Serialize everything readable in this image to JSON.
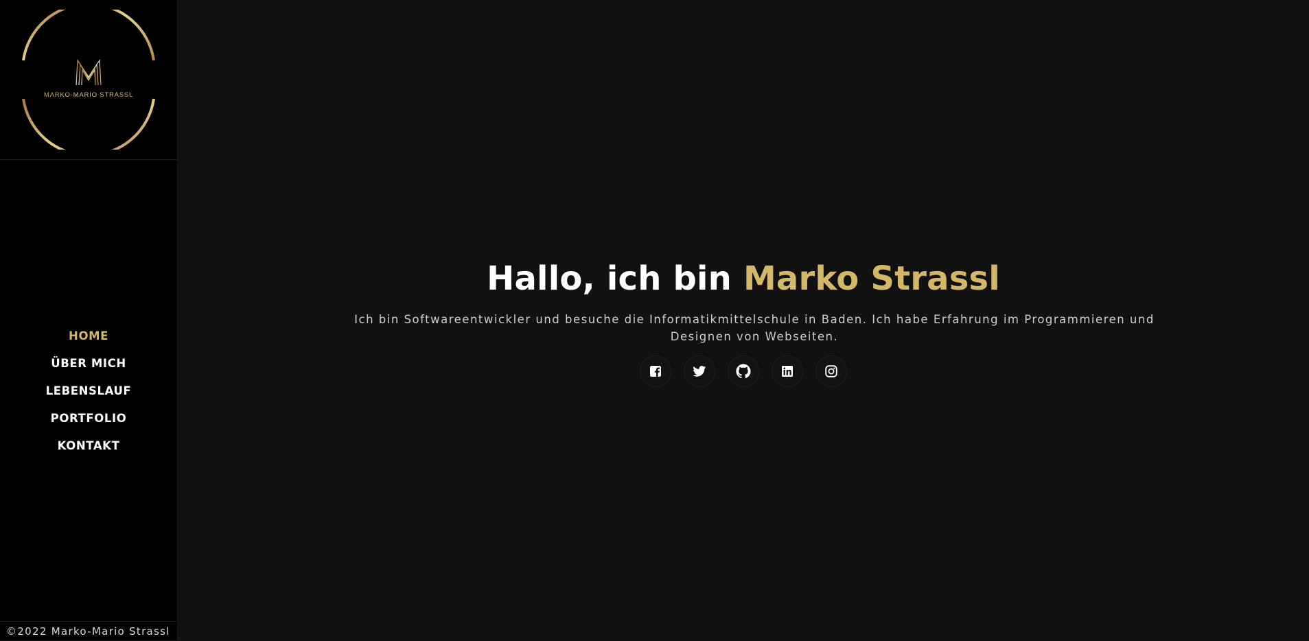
{
  "brand": {
    "logo_letter": "M",
    "logo_text": "MARKO-MARIO STRASSL"
  },
  "nav": {
    "items": [
      {
        "label": "HOME",
        "active": true
      },
      {
        "label": "ÜBER MICH",
        "active": false
      },
      {
        "label": "LEBENSLAUF",
        "active": false
      },
      {
        "label": "PORTFOLIO",
        "active": false
      },
      {
        "label": "KONTAKT",
        "active": false
      }
    ]
  },
  "hero": {
    "title_prefix": "Hallo, ich bin ",
    "title_name": "Marko Strassl",
    "description": "Ich bin Softwareentwickler und besuche die Informatikmittelschule in Baden. Ich habe Erfahrung im Programmieren und Designen von Webseiten."
  },
  "socials": [
    {
      "icon": "facebook-icon"
    },
    {
      "icon": "twitter-icon"
    },
    {
      "icon": "github-icon"
    },
    {
      "icon": "linkedin-icon"
    },
    {
      "icon": "instagram-icon"
    }
  ],
  "footer": {
    "copyright": "©2022 Marko-Mario Strassl"
  },
  "colors": {
    "accent": "#d4b86a",
    "sidebar_bg": "#000000",
    "main_bg": "#111111",
    "text": "#ffffff"
  }
}
